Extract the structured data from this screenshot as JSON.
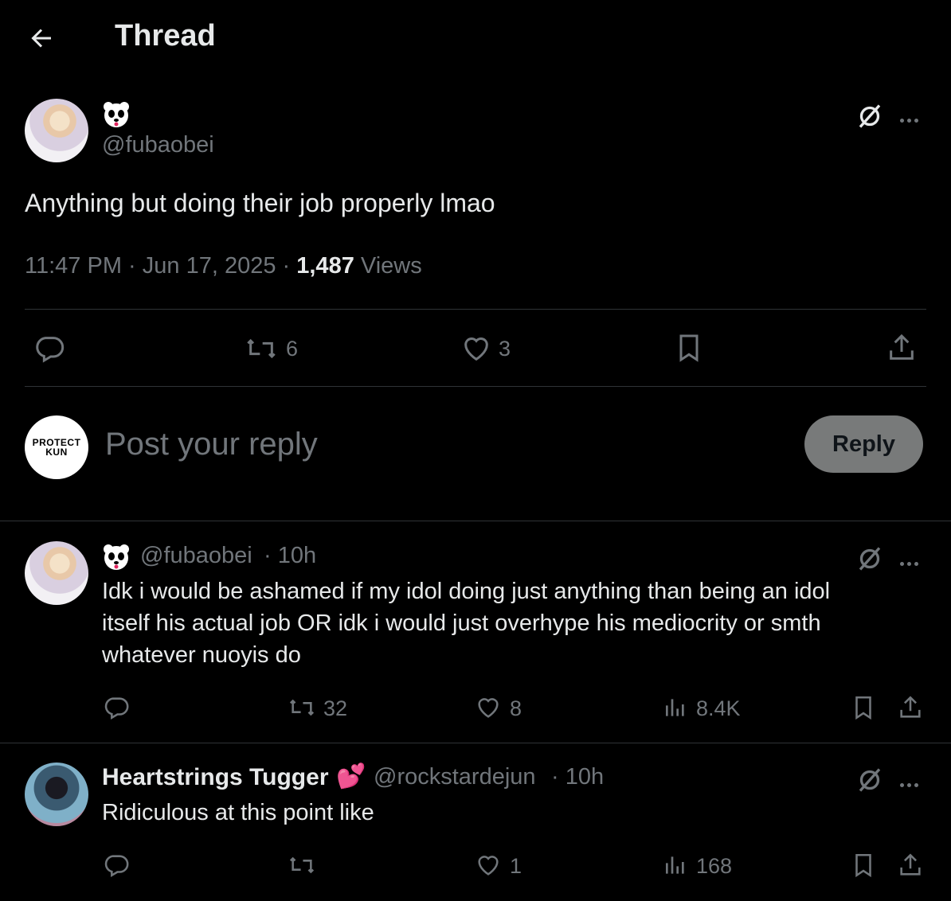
{
  "header": {
    "title": "Thread"
  },
  "main_tweet": {
    "handle": "@fubaobei",
    "text": "Anything but doing their job properly lmao",
    "time": "11:47 PM",
    "date": "Jun 17, 2025",
    "views_count": "1,487",
    "views_label": "Views",
    "retweets": "6",
    "likes": "3"
  },
  "composer": {
    "avatar_text_line1": "PROTECT",
    "avatar_text_line2": "KUN",
    "placeholder": "Post your reply",
    "reply_button": "Reply"
  },
  "replies": [
    {
      "handle": "@fubaobei",
      "age": "· 10h",
      "text_line1": "Idk i would be ashamed if my idol doing just anything than being an idol",
      "text_line2": "itself his actual job OR idk i would just overhype his mediocrity or smth",
      "text_line3": "whatever nuoyis do",
      "retweets": "32",
      "likes": "8",
      "views": "8.4K"
    },
    {
      "name": "Heartstrings Tugger",
      "emoji": "💕",
      "handle": "@rockstardejun",
      "age": "· 10h",
      "text_line1": "Ridiculous at this point like",
      "retweets": "",
      "likes": "1",
      "views": "168"
    }
  ],
  "colors": {
    "background": "#000000",
    "text": "#e7e9ea",
    "muted": "#71767b",
    "divider": "#2f3336",
    "reply_button": "#787a7a"
  },
  "icons": [
    "back-arrow-icon",
    "panda-emoji-icon",
    "grok-icon",
    "more-icon",
    "reply-icon",
    "retweet-icon",
    "like-icon",
    "bookmark-icon",
    "share-icon",
    "views-icon"
  ]
}
